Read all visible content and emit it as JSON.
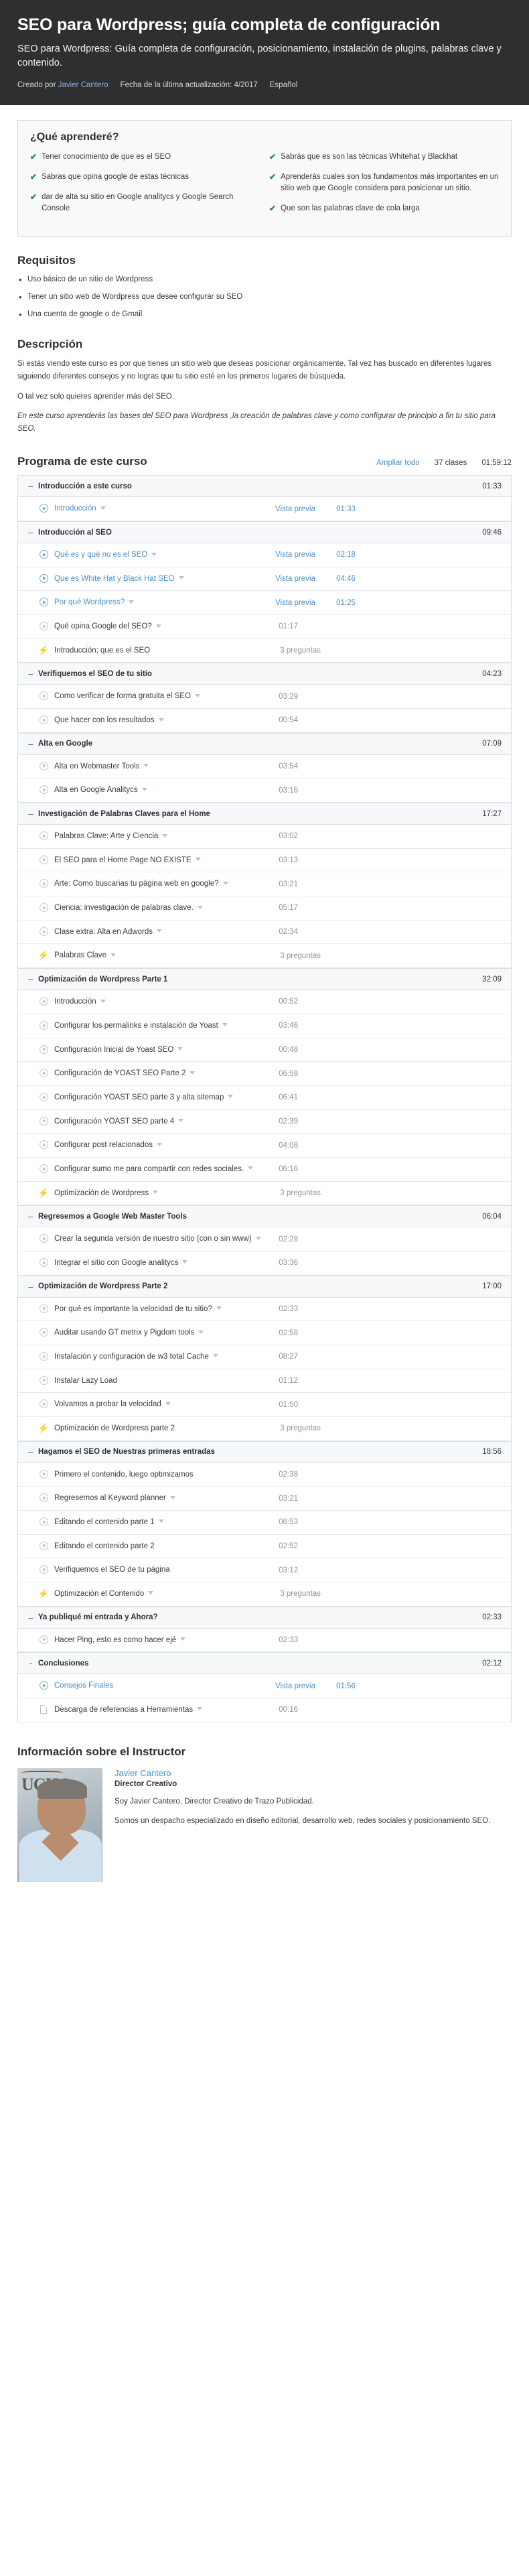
{
  "hero": {
    "title": "SEO para Wordpress; guía completa de configuración",
    "subtitle": "SEO para Wordpress: Guía completa de configuración, posicionamiento, instalación de plugins, palabras clave y contenido.",
    "created_by_label": "Creado por",
    "author": "Javier Cantero",
    "updated": "Fecha de la última actualización: 4/2017",
    "language": "Español"
  },
  "learn": {
    "title": "¿Qué aprenderé?",
    "left": [
      "Tener conocimiento de que es el SEO",
      "Sabras que opina google de estas técnicas",
      "dar de alta su sitio en Google analitycs y Google Search Console"
    ],
    "right": [
      "Sabrás que es son las técnicas Whitehat y Blackhat",
      "Aprenderás cuales son los fundamentos más importantes en un sitio web que Google considera para posicionar un sitio.",
      "Que son las palabras clave de cola larga"
    ]
  },
  "requisitos": {
    "title": "Requisitos",
    "items": [
      "Uso básico de un sitio de Wordpress",
      "Tener un sitio web de Wordpress que desee configurar su SEO",
      "Una cuenta de google o de Gmail"
    ]
  },
  "descripcion": {
    "title": "Descripción",
    "paragraphs": [
      "Si estás viendo este curso es por que tienes un sitio web que deseas posicionar orgánicamente. Tal vez has buscado en diferentes lugares siguiendo diferentes consejos y no logras que tu sitio esté en los primeros lugares de búsqueda.",
      "O tal vez solo quieres aprender más del SEO."
    ],
    "italic_paragraph": "En este curso aprenderás las bases del SEO para Wordpress ,la creación de palabras clave y como configurar de principio a fin tu sitio para SEO."
  },
  "programa": {
    "title": "Programa de este curso",
    "expand_all": "Ampliar todo",
    "classes": "37 clases",
    "total_time": "01:59:12",
    "preview_label": "Vista previa",
    "sections": [
      {
        "name": "Introducción a este curso",
        "duration": "01:33",
        "toggle": "–",
        "lectures": [
          {
            "icon": "play-icon",
            "title": "Introducción",
            "caret": true,
            "preview": true,
            "duration": "01:33"
          }
        ]
      },
      {
        "name": "Introducción al SEO",
        "duration": "09:46",
        "toggle": "–",
        "lectures": [
          {
            "icon": "play-icon",
            "title": "Qué es y qué no es el SEO",
            "caret": true,
            "preview": true,
            "duration": "02:18"
          },
          {
            "icon": "play-icon",
            "title": "Que es White Hat y Black Hat SEO",
            "caret": true,
            "preview": true,
            "duration": "04:46"
          },
          {
            "icon": "play-icon",
            "title": "Por qué Wordpress?",
            "caret": true,
            "preview": true,
            "duration": "01:25"
          },
          {
            "icon": "play-icon",
            "title": "Qué opina Google del SEO?",
            "caret": true,
            "preview": false,
            "duration": "01:17"
          },
          {
            "icon": "quiz-icon",
            "title": "Introducción; que es el SEO",
            "caret": false,
            "preview": false,
            "duration": "3 preguntas"
          }
        ]
      },
      {
        "name": "Verifiquemos el SEO de tu sitio",
        "duration": "04:23",
        "toggle": "–",
        "lectures": [
          {
            "icon": "play-icon",
            "title": "Como verificar de forma gratuita el SEO",
            "caret": true,
            "preview": false,
            "duration": "03:29"
          },
          {
            "icon": "play-icon",
            "title": "Que hacer con los resultados",
            "caret": true,
            "preview": false,
            "duration": "00:54"
          }
        ]
      },
      {
        "name": "Alta en Google",
        "duration": "07:09",
        "toggle": "–",
        "lectures": [
          {
            "icon": "play-icon",
            "title": "Alta en Webmaster Tools",
            "caret": true,
            "preview": false,
            "duration": "03:54"
          },
          {
            "icon": "play-icon",
            "title": "Alta en Google Analitycs",
            "caret": true,
            "preview": false,
            "duration": "03:15"
          }
        ]
      },
      {
        "name": "Investigación de Palabras Claves para el Home",
        "duration": "17:27",
        "toggle": "–",
        "lectures": [
          {
            "icon": "play-icon",
            "title": "Palabras Clave: Arte y Ciencia",
            "caret": true,
            "preview": false,
            "duration": "03:02"
          },
          {
            "icon": "play-icon",
            "title": "El SEO para el Home Page NO EXISTE",
            "caret": true,
            "preview": false,
            "duration": "03:13"
          },
          {
            "icon": "play-icon",
            "title": "Arte: Como buscarias tu página web en google?",
            "caret": true,
            "preview": false,
            "duration": "03:21"
          },
          {
            "icon": "play-icon",
            "title": "Ciencia: investigación de palabras clave.",
            "caret": true,
            "preview": false,
            "duration": "05:17"
          },
          {
            "icon": "play-icon",
            "title": "Clase extra: Alta en Adwords",
            "caret": true,
            "preview": false,
            "duration": "02:34"
          },
          {
            "icon": "quiz-icon",
            "title": "Palabras Clave",
            "caret": true,
            "preview": false,
            "duration": "3 preguntas"
          }
        ]
      },
      {
        "name": "Optimización de Wordpress Parte 1",
        "duration": "32:09",
        "toggle": "–",
        "lectures": [
          {
            "icon": "play-icon",
            "title": "Introducción",
            "caret": true,
            "preview": false,
            "duration": "00:52"
          },
          {
            "icon": "play-icon",
            "title": "Configurar los permalinks e instalación de Yoast",
            "caret": true,
            "preview": false,
            "duration": "03:46"
          },
          {
            "icon": "play-icon",
            "title": "Configuración Inicial de Yoast SEO",
            "caret": true,
            "preview": false,
            "duration": "00:48"
          },
          {
            "icon": "play-icon",
            "title": "Configuración de YOAST SEO Parte 2",
            "caret": true,
            "preview": false,
            "duration": "06:59"
          },
          {
            "icon": "play-icon",
            "title": "Configuración YOAST SEO parte 3 y alta sitemap",
            "caret": true,
            "preview": false,
            "duration": "06:41"
          },
          {
            "icon": "play-icon",
            "title": "Configuración YOAST SEO parte 4",
            "caret": true,
            "preview": false,
            "duration": "02:39"
          },
          {
            "icon": "play-icon",
            "title": "Configurar post relacionados",
            "caret": true,
            "preview": false,
            "duration": "04:08"
          },
          {
            "icon": "play-icon",
            "title": "Configurar sumo me para compartir con redes sociales.",
            "caret": true,
            "preview": false,
            "duration": "06:16"
          },
          {
            "icon": "quiz-icon",
            "title": "Optimización de Wordpress",
            "caret": true,
            "preview": false,
            "duration": "3 preguntas"
          }
        ]
      },
      {
        "name": "Regresemos a Google Web Master Tools",
        "duration": "06:04",
        "toggle": "–",
        "lectures": [
          {
            "icon": "play-icon",
            "title": "Crear la segunda versión de nuestro sitio (con o sin www)",
            "caret": true,
            "preview": false,
            "duration": "02:28"
          },
          {
            "icon": "play-icon",
            "title": "Integrar el sitio con Google analitycs",
            "caret": true,
            "preview": false,
            "duration": "03:36"
          }
        ]
      },
      {
        "name": "Optimización de Wordpress Parte 2",
        "duration": "17:00",
        "toggle": "–",
        "lectures": [
          {
            "icon": "play-icon",
            "title": "Por qué es importante la velocidad de tu sitio?",
            "caret": true,
            "preview": false,
            "duration": "02:33"
          },
          {
            "icon": "play-icon",
            "title": "Auditar usando GT metrix y Pigdom tools",
            "caret": true,
            "preview": false,
            "duration": "02:58"
          },
          {
            "icon": "play-icon",
            "title": "Instalación y configuración de w3 total Cache",
            "caret": true,
            "preview": false,
            "duration": "08:27"
          },
          {
            "icon": "play-icon",
            "title": "Instalar Lazy Load",
            "caret": false,
            "preview": false,
            "duration": "01:12"
          },
          {
            "icon": "play-icon",
            "title": "Volvamos a probar la velocidad",
            "caret": true,
            "preview": false,
            "duration": "01:50"
          },
          {
            "icon": "quiz-icon",
            "title": "Optimización de Wordpress parte 2",
            "caret": false,
            "preview": false,
            "duration": "3 preguntas"
          }
        ]
      },
      {
        "name": "Hagamos el SEO de Nuestras primeras entradas",
        "duration": "18:56",
        "toggle": "–",
        "lectures": [
          {
            "icon": "play-icon",
            "title": "Primero el contenido, luego optimizamos",
            "caret": false,
            "preview": false,
            "duration": "02:38"
          },
          {
            "icon": "play-icon",
            "title": "Regresemos al Keyword planner",
            "caret": true,
            "preview": false,
            "duration": "03:21"
          },
          {
            "icon": "play-icon",
            "title": "Editando el contenido parte 1",
            "caret": true,
            "preview": false,
            "duration": "06:53"
          },
          {
            "icon": "play-icon",
            "title": "Editando el contenido parte 2",
            "caret": false,
            "preview": false,
            "duration": "02:52"
          },
          {
            "icon": "play-icon",
            "title": "Verifiquemos el SEO de tu página",
            "caret": false,
            "preview": false,
            "duration": "03:12"
          },
          {
            "icon": "quiz-icon",
            "title": "Optimización el Contenido",
            "caret": true,
            "preview": false,
            "duration": "3 preguntas"
          }
        ]
      },
      {
        "name": "Ya publiqué mi entrada y Ahora?",
        "duration": "02:33",
        "toggle": "–",
        "lectures": [
          {
            "icon": "play-icon",
            "title": "Hacer Ping, esto es como hacer ejé",
            "caret": true,
            "preview": false,
            "duration": "02:33"
          }
        ]
      },
      {
        "name": "Conclusiones",
        "duration": "02:12",
        "toggle": "-",
        "lectures": [
          {
            "icon": "play-icon",
            "title": "Consejos Finales",
            "caret": false,
            "preview": true,
            "duration": "01:56"
          },
          {
            "icon": "doc-icon",
            "title": "Descarga de referencias a Herramientas",
            "caret": true,
            "preview": false,
            "duration": "00:16"
          }
        ]
      }
    ]
  },
  "instructor": {
    "title": "Información sobre el Instructor",
    "name": "Javier Cantero",
    "role": "Director Creativo",
    "bio1": "Soy Javier Cantero, Director Creativo de Trazo Publicidad.",
    "bio2": "Somos un despacho especializado en diseño editorial, desarrollo web, redes sociales y posicionamiento SEO.",
    "avatar_text": "UCHO"
  },
  "colors": {
    "hero_bg": "#2d2f31",
    "link": "#4a90c4",
    "check_green": "#1e8a3b",
    "section_bg": "#f7f8fa",
    "border": "#d6dde3"
  }
}
